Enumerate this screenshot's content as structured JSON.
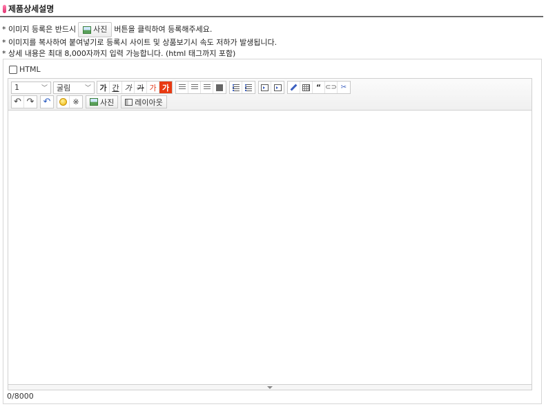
{
  "header": {
    "title": "제품상세설명"
  },
  "notes": {
    "line1_before": "* 이미지 등록은 반드시",
    "line1_button": "사진",
    "line1_after": "버튼을 클릭하여 등록해주세요.",
    "line2": "* 이미지를 복사하여 붙여넣기로 등록시 사이트 및 상품보기시 속도 저하가 발생됩니다.",
    "line3": "* 상세 내용은 최대 8,000자까지 입력 가능합니다. (html 태그까지 포함)"
  },
  "editor": {
    "html_label": "HTML",
    "html_checked": false,
    "font_size_value": "1",
    "font_family_value": "굴림",
    "buttons": {
      "bold": "가",
      "underline": "간",
      "italic": "가",
      "strike": "가",
      "font_color": "가",
      "bg_color": "가",
      "photo": "사진",
      "layout": "레이아웃",
      "quote": "“",
      "special_char": "※"
    },
    "icons": {
      "undo": "undo-icon",
      "redo": "redo-icon",
      "reset": "reset-icon",
      "emoji": "emoticon-icon",
      "link": "link-icon",
      "unlink": "unlink-icon"
    },
    "char_count": "0/8000"
  },
  "colors": {
    "accent_pink": "#e0306f",
    "font_color_red": "#e03c1e",
    "bg_color_red": "#e83a12"
  }
}
